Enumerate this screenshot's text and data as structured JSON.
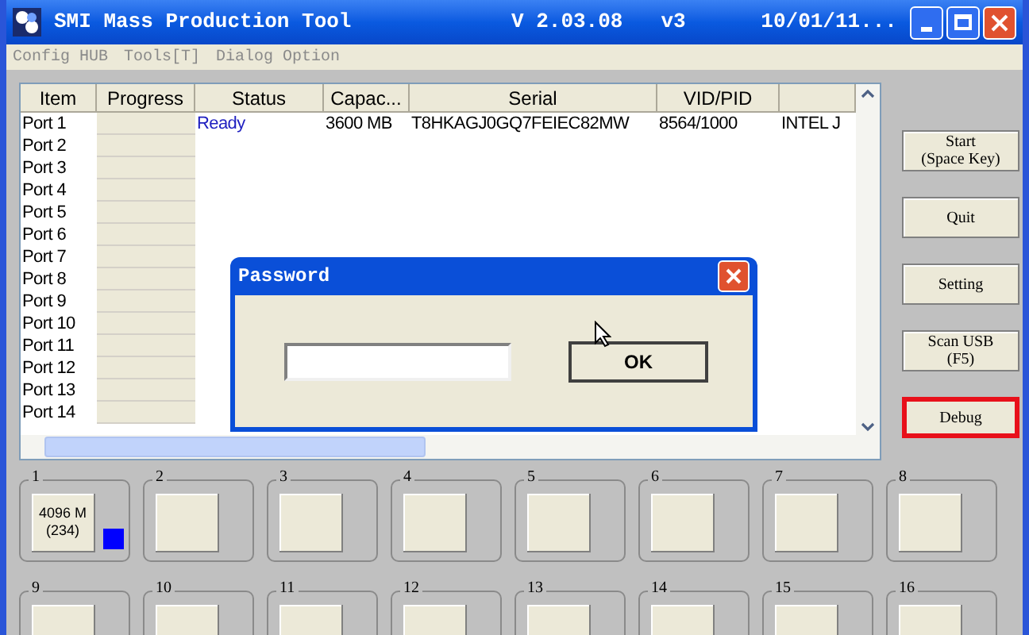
{
  "window": {
    "title": "SMI Mass Production Tool",
    "version": "V 2.03.08",
    "build": "v3",
    "date": "10/01/11..."
  },
  "menu": [
    "Config HUB",
    "Tools[T]",
    "Dialog Option"
  ],
  "table": {
    "columns": [
      "Item",
      "Progress",
      "Status",
      "Capac...",
      "Serial",
      "VID/PID",
      ""
    ],
    "rows": [
      {
        "item": "Port 1",
        "status": "Ready",
        "capacity": "3600 MB",
        "serial": "T8HKAGJ0GQ7FEIEC82MW",
        "vid_pid": "8564/1000",
        "column_7": "INTEL J"
      },
      {
        "item": "Port 2"
      },
      {
        "item": "Port 3"
      },
      {
        "item": "Port 4"
      },
      {
        "item": "Port 5"
      },
      {
        "item": "Port 6"
      },
      {
        "item": "Port 7"
      },
      {
        "item": "Port 8"
      },
      {
        "item": "Port 9"
      },
      {
        "item": "Port 10"
      },
      {
        "item": "Port 11"
      },
      {
        "item": "Port 12"
      },
      {
        "item": "Port 13"
      },
      {
        "item": "Port 14"
      }
    ]
  },
  "buttons": [
    {
      "lines": [
        "Start",
        "(Space Key)"
      ],
      "highlighted": false
    },
    {
      "lines": [
        "Quit"
      ],
      "highlighted": false
    },
    {
      "lines": [
        "Setting"
      ],
      "highlighted": false
    },
    {
      "lines": [
        "Scan USB",
        "(F5)"
      ],
      "highlighted": false
    },
    {
      "lines": [
        "Debug"
      ],
      "highlighted": true
    }
  ],
  "ports": [
    {
      "label": "1",
      "lines": [
        "4096 M",
        "(234)"
      ],
      "color": "#0000ff"
    },
    {
      "label": "2"
    },
    {
      "label": "3"
    },
    {
      "label": "4"
    },
    {
      "label": "5"
    },
    {
      "label": "6"
    },
    {
      "label": "7"
    },
    {
      "label": "8"
    },
    {
      "label": "9"
    },
    {
      "label": "10"
    },
    {
      "label": "11"
    },
    {
      "label": "12"
    },
    {
      "label": "13"
    },
    {
      "label": "14"
    },
    {
      "label": "15"
    },
    {
      "label": "16"
    }
  ],
  "dialog": {
    "title": "Password",
    "button": "OK"
  }
}
